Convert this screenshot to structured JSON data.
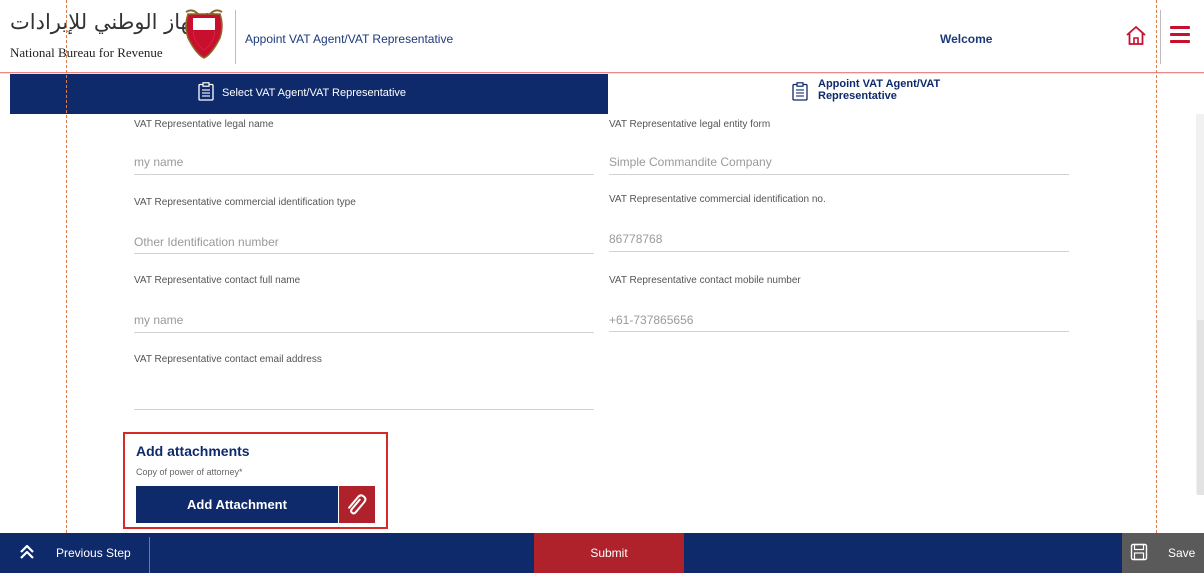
{
  "header": {
    "logo_arabic": "الجهاز الوطني للإيرادات",
    "logo_english": "National Bureau for Revenue",
    "title": "Appoint VAT Agent/VAT Representative",
    "welcome": "Welcome"
  },
  "steps": [
    {
      "label": "Select VAT Agent/VAT Representative",
      "active": true
    },
    {
      "label": "Appoint VAT Agent/VAT Representative",
      "active": false
    }
  ],
  "form": {
    "legal_name": {
      "label": "VAT Representative legal name",
      "value": "my name"
    },
    "legal_entity_form": {
      "label": "VAT Representative legal entity form",
      "value": "Simple Commandite Company"
    },
    "commercial_id_type": {
      "label": "VAT Representative commercial identification type",
      "value": "Other Identification number"
    },
    "commercial_id_no": {
      "label": "VAT Representative commercial identification no.",
      "value": "86778768"
    },
    "contact_full_name": {
      "label": "VAT Representative contact full name",
      "value": "my name"
    },
    "contact_mobile": {
      "label": "VAT Representative contact mobile number",
      "value": "+61-737865656"
    },
    "contact_email": {
      "label": "VAT Representative contact email address",
      "value": ""
    }
  },
  "attachments": {
    "title": "Add attachments",
    "subtitle": "Copy of power of attorney*",
    "button_label": "Add Attachment"
  },
  "footer": {
    "previous_label": "Previous Step",
    "submit_label": "Submit",
    "save_label": "Save"
  },
  "colors": {
    "primary_navy": "#0f2a6b",
    "accent_red": "#b0222b",
    "highlight_red": "#d42a2a",
    "save_gray": "#5a5a5a"
  }
}
